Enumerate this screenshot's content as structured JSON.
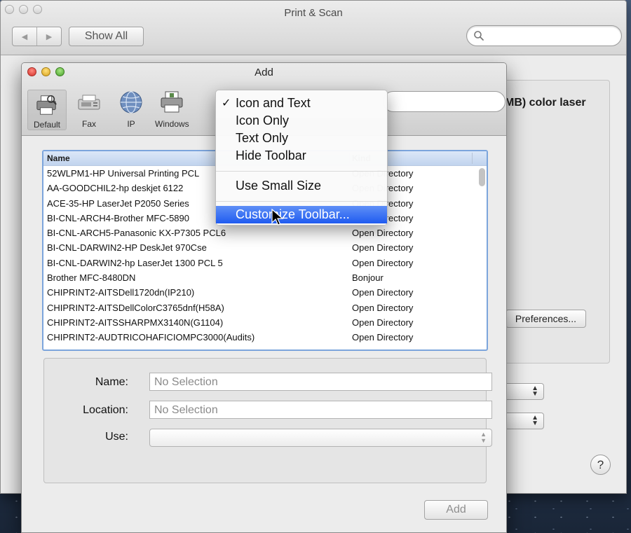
{
  "main_window": {
    "title": "Print & Scan",
    "nav_back": "◀",
    "nav_forward": "▶",
    "show_all": "Show All",
    "printer_name_partial": "MB) color laser",
    "preferences_button": "Preferences...",
    "help": "?"
  },
  "add_window": {
    "title": "Add",
    "toolbar": {
      "default_label": "Default",
      "fax_label": "Fax",
      "ip_label": "IP",
      "windows_label": "Windows"
    },
    "list": {
      "col_name": "Name",
      "col_kind": "Kind",
      "rows": [
        {
          "name": "52WLPM1-HP Universal Printing PCL",
          "kind": "Open Directory"
        },
        {
          "name": "AA-GOODCHIL2-hp deskjet 6122",
          "kind": "Open Directory"
        },
        {
          "name": "ACE-35-HP LaserJet P2050 Series",
          "kind": "Open Directory"
        },
        {
          "name": "BI-CNL-ARCH4-Brother MFC-5890",
          "kind": "Open Directory"
        },
        {
          "name": "BI-CNL-ARCH5-Panasonic KX-P7305 PCL6",
          "kind": "Open Directory"
        },
        {
          "name": "BI-CNL-DARWIN2-HP DeskJet 970Cse",
          "kind": "Open Directory"
        },
        {
          "name": "BI-CNL-DARWIN2-hp LaserJet 1300 PCL 5",
          "kind": "Open Directory"
        },
        {
          "name": "Brother MFC-8480DN",
          "kind": "Bonjour"
        },
        {
          "name": "CHIPRINT2-AITSDell1720dn(IP210)",
          "kind": "Open Directory"
        },
        {
          "name": "CHIPRINT2-AITSDellColorC3765dnf(H58A)",
          "kind": "Open Directory"
        },
        {
          "name": "CHIPRINT2-AITSSHARPMX3140N(G1104)",
          "kind": "Open Directory"
        },
        {
          "name": "CHIPRINT2-AUDTRICOHAFICIOMPC3000(Audits)",
          "kind": "Open Directory"
        }
      ]
    },
    "details": {
      "name_label": "Name:",
      "name_value": "No Selection",
      "location_label": "Location:",
      "location_value": "No Selection",
      "use_label": "Use:",
      "use_value": ""
    },
    "add_button": "Add"
  },
  "context_menu": {
    "check_mark": "✓",
    "items": [
      {
        "label": "Icon and Text",
        "checked": true
      },
      {
        "label": "Icon Only",
        "checked": false
      },
      {
        "label": "Text Only",
        "checked": false
      },
      {
        "label": "Hide Toolbar",
        "checked": false
      },
      {
        "label": "Use Small Size",
        "checked": false
      },
      {
        "label": "Customize Toolbar...",
        "checked": false,
        "highlighted": true
      }
    ]
  },
  "colors": {
    "selection_blue": "#1f5bf0",
    "list_border": "#7ca5dc"
  }
}
